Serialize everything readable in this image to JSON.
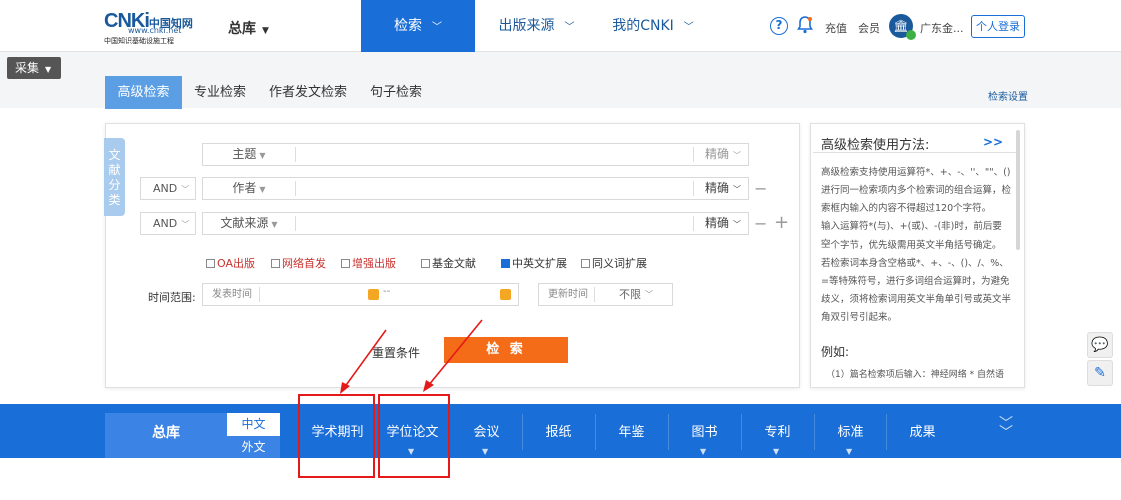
{
  "header": {
    "logo_text": "CNKi",
    "logo_cn": "中国知网",
    "logo_url": "www.cnki.net",
    "logo_sub": "中国知识基础设施工程",
    "database": "总库",
    "nav": [
      {
        "label": "检索",
        "active": true
      },
      {
        "label": "出版来源",
        "active": false
      },
      {
        "label": "我的CNKI",
        "active": false
      }
    ],
    "recharge": "充值",
    "member": "会员",
    "institution": "广东金...",
    "login": "个人登录"
  },
  "collect": "采集",
  "search_tabs": [
    "高级检索",
    "专业检索",
    "作者发文检索",
    "句子检索"
  ],
  "search_settings": "检索设置",
  "side_tag": "文献分类",
  "fields": [
    {
      "name": "主题",
      "precision": "精确"
    },
    {
      "bool": "AND",
      "name": "作者",
      "precision": "精确"
    },
    {
      "bool": "AND",
      "name": "文献来源",
      "precision": "精确"
    }
  ],
  "options": [
    {
      "label": "OA出版",
      "checked": false,
      "highlight": true
    },
    {
      "label": "网络首发",
      "checked": false,
      "highlight": true
    },
    {
      "label": "增强出版",
      "checked": false,
      "highlight": true
    },
    {
      "label": "基金文献",
      "checked": false,
      "highlight": false
    },
    {
      "label": "中英文扩展",
      "checked": true,
      "highlight": false
    },
    {
      "label": "同义词扩展",
      "checked": false,
      "highlight": false
    }
  ],
  "time": {
    "label": "时间范围:",
    "publish_time": "发表时间",
    "separator": "--",
    "update_time": "更新时间",
    "update_value": "不限"
  },
  "reset": "重置条件",
  "search_button": "检 索",
  "help": {
    "title": "高级检索使用方法:",
    "more": ">>",
    "lines": [
      "高级检索支持使用运算符*、+、-、''、\"\"、()",
      "进行同一检索项内多个检索词的组合运算，检",
      "索框内输入的内容不得超过120个字符。",
      "输入运算符*(与)、+(或)、-(非)时，前后要空",
      "一个字节，优先级需用英文半角括号确定。",
      "若检索词本身含空格或*、+、-、()、/、%、",
      "=等特殊符号，进行多词组合运算时，为避免",
      "歧义，须将检索词用英文半角单引号或英文半",
      "角双引号引起来。"
    ],
    "example_title": "例如:",
    "example_line": "（1）篇名检索项后输入：神经网络 * 自然语"
  },
  "bottom": {
    "zongku": "总库",
    "zh": "中文",
    "wen": "外文",
    "tabs": [
      "学术期刊",
      "学位论文",
      "会议",
      "报纸",
      "年鉴",
      "图书",
      "专利",
      "标准",
      "成果"
    ]
  },
  "colors": {
    "accent": "#1a6ed7",
    "search_button": "#f46c18",
    "annotation": "#e61919"
  }
}
